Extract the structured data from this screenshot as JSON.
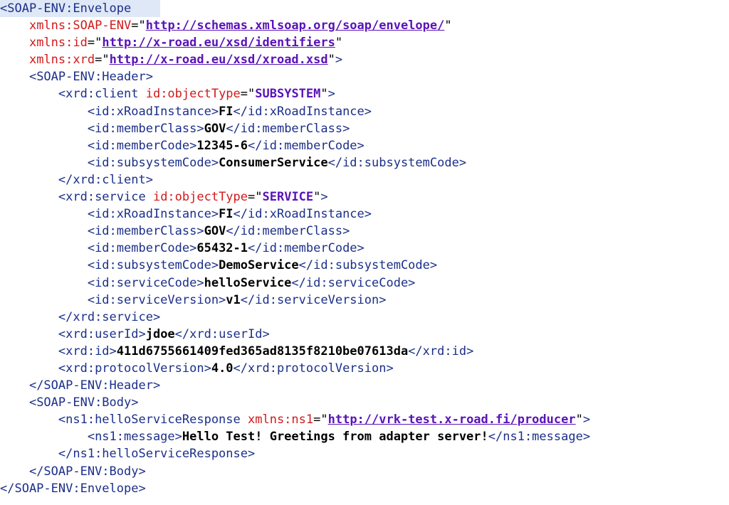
{
  "lines": [
    [
      {
        "t": "<SOAP-ENV:Envelope",
        "c": "tag"
      }
    ],
    [
      {
        "t": "    "
      },
      {
        "t": "xmlns:SOAP-ENV",
        "c": "attr"
      },
      {
        "t": "=\"",
        "c": "eq"
      },
      {
        "t": "http://schemas.xmlsoap.org/soap/envelope/",
        "c": "link"
      },
      {
        "t": "\"",
        "c": "quote"
      }
    ],
    [
      {
        "t": "    "
      },
      {
        "t": "xmlns:id",
        "c": "attr"
      },
      {
        "t": "=\"",
        "c": "eq"
      },
      {
        "t": "http://x-road.eu/xsd/identifiers",
        "c": "link"
      },
      {
        "t": "\"",
        "c": "quote"
      }
    ],
    [
      {
        "t": "    "
      },
      {
        "t": "xmlns:xrd",
        "c": "attr"
      },
      {
        "t": "=\"",
        "c": "eq"
      },
      {
        "t": "http://x-road.eu/xsd/xroad.xsd",
        "c": "link"
      },
      {
        "t": "\"",
        "c": "quote"
      },
      {
        "t": ">",
        "c": "tag"
      }
    ],
    [
      {
        "t": "    "
      },
      {
        "t": "<SOAP-ENV:Header>",
        "c": "tag"
      }
    ],
    [
      {
        "t": "        "
      },
      {
        "t": "<xrd:client ",
        "c": "tag"
      },
      {
        "t": "id:objectType",
        "c": "attr"
      },
      {
        "t": "=\"",
        "c": "eq"
      },
      {
        "t": "SUBSYSTEM",
        "c": "aval"
      },
      {
        "t": "\"",
        "c": "quote"
      },
      {
        "t": ">",
        "c": "tag"
      }
    ],
    [
      {
        "t": "            "
      },
      {
        "t": "<id:xRoadInstance>",
        "c": "tag"
      },
      {
        "t": "FI",
        "c": "text"
      },
      {
        "t": "</id:xRoadInstance>",
        "c": "tag"
      }
    ],
    [
      {
        "t": "            "
      },
      {
        "t": "<id:memberClass>",
        "c": "tag"
      },
      {
        "t": "GOV",
        "c": "text"
      },
      {
        "t": "</id:memberClass>",
        "c": "tag"
      }
    ],
    [
      {
        "t": "            "
      },
      {
        "t": "<id:memberCode>",
        "c": "tag"
      },
      {
        "t": "12345-6",
        "c": "text"
      },
      {
        "t": "</id:memberCode>",
        "c": "tag"
      }
    ],
    [
      {
        "t": "            "
      },
      {
        "t": "<id:subsystemCode>",
        "c": "tag"
      },
      {
        "t": "ConsumerService",
        "c": "text"
      },
      {
        "t": "</id:subsystemCode>",
        "c": "tag"
      }
    ],
    [
      {
        "t": "        "
      },
      {
        "t": "</xrd:client>",
        "c": "tag"
      }
    ],
    [
      {
        "t": "        "
      },
      {
        "t": "<xrd:service ",
        "c": "tag"
      },
      {
        "t": "id:objectType",
        "c": "attr"
      },
      {
        "t": "=\"",
        "c": "eq"
      },
      {
        "t": "SERVICE",
        "c": "aval"
      },
      {
        "t": "\"",
        "c": "quote"
      },
      {
        "t": ">",
        "c": "tag"
      }
    ],
    [
      {
        "t": "            "
      },
      {
        "t": "<id:xRoadInstance>",
        "c": "tag"
      },
      {
        "t": "FI",
        "c": "text"
      },
      {
        "t": "</id:xRoadInstance>",
        "c": "tag"
      }
    ],
    [
      {
        "t": "            "
      },
      {
        "t": "<id:memberClass>",
        "c": "tag"
      },
      {
        "t": "GOV",
        "c": "text"
      },
      {
        "t": "</id:memberClass>",
        "c": "tag"
      }
    ],
    [
      {
        "t": "            "
      },
      {
        "t": "<id:memberCode>",
        "c": "tag"
      },
      {
        "t": "65432-1",
        "c": "text"
      },
      {
        "t": "</id:memberCode>",
        "c": "tag"
      }
    ],
    [
      {
        "t": "            "
      },
      {
        "t": "<id:subsystemCode>",
        "c": "tag"
      },
      {
        "t": "DemoService",
        "c": "text"
      },
      {
        "t": "</id:subsystemCode>",
        "c": "tag"
      }
    ],
    [
      {
        "t": "            "
      },
      {
        "t": "<id:serviceCode>",
        "c": "tag"
      },
      {
        "t": "helloService",
        "c": "text"
      },
      {
        "t": "</id:serviceCode>",
        "c": "tag"
      }
    ],
    [
      {
        "t": "            "
      },
      {
        "t": "<id:serviceVersion>",
        "c": "tag"
      },
      {
        "t": "v1",
        "c": "text"
      },
      {
        "t": "</id:serviceVersion>",
        "c": "tag"
      }
    ],
    [
      {
        "t": "        "
      },
      {
        "t": "</xrd:service>",
        "c": "tag"
      }
    ],
    [
      {
        "t": "        "
      },
      {
        "t": "<xrd:userId>",
        "c": "tag"
      },
      {
        "t": "jdoe",
        "c": "text"
      },
      {
        "t": "</xrd:userId>",
        "c": "tag"
      }
    ],
    [
      {
        "t": "        "
      },
      {
        "t": "<xrd:id>",
        "c": "tag"
      },
      {
        "t": "411d6755661409fed365ad8135f8210be07613da",
        "c": "text"
      },
      {
        "t": "</xrd:id>",
        "c": "tag"
      }
    ],
    [
      {
        "t": "        "
      },
      {
        "t": "<xrd:protocolVersion>",
        "c": "tag"
      },
      {
        "t": "4.0",
        "c": "text"
      },
      {
        "t": "</xrd:protocolVersion>",
        "c": "tag"
      }
    ],
    [
      {
        "t": "    "
      },
      {
        "t": "</SOAP-ENV:Header>",
        "c": "tag"
      }
    ],
    [
      {
        "t": "    "
      },
      {
        "t": "<SOAP-ENV:Body>",
        "c": "tag"
      }
    ],
    [
      {
        "t": "        "
      },
      {
        "t": "<ns1:helloServiceResponse ",
        "c": "tag"
      },
      {
        "t": "xmlns:ns1",
        "c": "attr"
      },
      {
        "t": "=\"",
        "c": "eq"
      },
      {
        "t": "http://vrk-test.x-road.fi/producer",
        "c": "link"
      },
      {
        "t": "\"",
        "c": "quote"
      },
      {
        "t": ">",
        "c": "tag"
      }
    ],
    [
      {
        "t": "            "
      },
      {
        "t": "<ns1:message>",
        "c": "tag"
      },
      {
        "t": "Hello Test! Greetings from adapter server!",
        "c": "text"
      },
      {
        "t": "</ns1:message>",
        "c": "tag"
      }
    ],
    [
      {
        "t": "        "
      },
      {
        "t": "</ns1:helloServiceResponse>",
        "c": "tag"
      }
    ],
    [
      {
        "t": "    "
      },
      {
        "t": "</SOAP-ENV:Body>",
        "c": "tag"
      }
    ],
    [
      {
        "t": "</SOAP-ENV:Envelope>",
        "c": "tag"
      }
    ]
  ]
}
